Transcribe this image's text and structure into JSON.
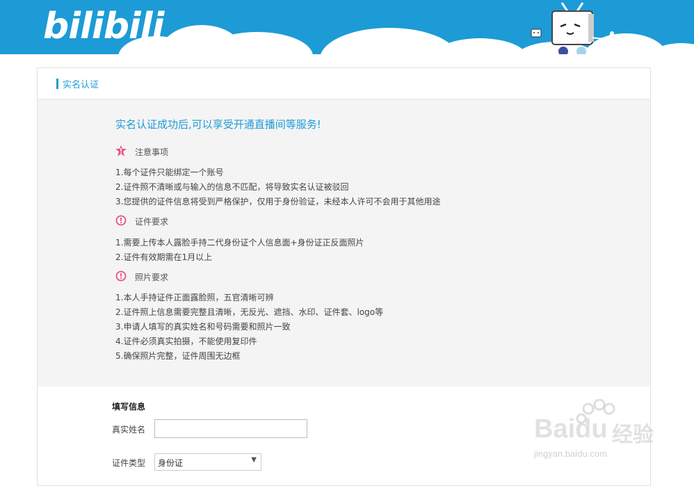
{
  "header": {
    "logo_text": "bilibili",
    "brand_color": "#1d9bd6"
  },
  "panel": {
    "title": "实名认证"
  },
  "notice": {
    "headline": "实名认证成功后,可以享受开通直播间等服务!",
    "sections": [
      {
        "icon": "warning-star-icon",
        "title": "注意事项",
        "lines": [
          "1.每个证件只能绑定一个账号",
          "2.证件照不清晰或与输入的信息不匹配，将导致实名认证被驳回",
          "3.您提供的证件信息将受到严格保护，仅用于身份验证，未经本人许可不会用于其他用途"
        ]
      },
      {
        "icon": "exclamation-circle-icon",
        "title": "证件要求",
        "lines": [
          "1.需要上传本人露脸手持二代身份证个人信息面+身份证正反面照片",
          "2.证件有效期需在1月以上"
        ]
      },
      {
        "icon": "exclamation-circle-icon",
        "title": "照片要求",
        "lines": [
          "1.本人手持证件正面露脸照，五官清晰可辨",
          "2.证件照上信息需要完整且清晰，无反光、遮挡、水印、证件套、logo等",
          "3.申请人填写的真实姓名和号码需要和照片一致",
          "4.证件必须真实拍摄，不能使用复印件",
          "5.确保照片完整，证件周围无边框"
        ]
      }
    ]
  },
  "form": {
    "heading": "填写信息",
    "name_label": "真实姓名",
    "name_value": "",
    "id_type_label": "证件类型",
    "id_type_value": "身份证"
  },
  "watermark": {
    "brand": "Bai",
    "brand2": "du",
    "cn": "经验",
    "url": "jingyan.baidu.com"
  }
}
